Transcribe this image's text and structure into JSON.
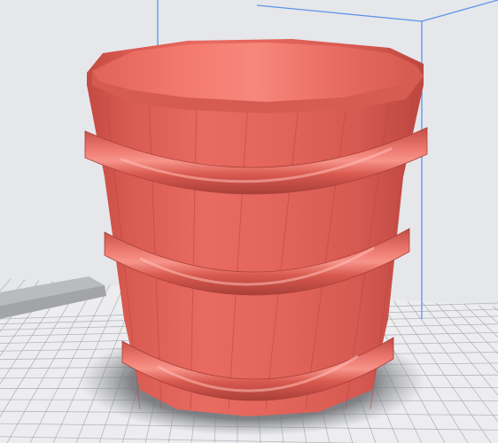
{
  "viewport": {
    "background_color": "#e3e4e8",
    "bed_color": "#ececee",
    "grid_color": "#9aa0a8",
    "build_volume_color": "#4f8fe6",
    "model_color": "#e4675e",
    "model_dark_color": "#c0463f",
    "model_light_color": "#f48a80",
    "shadow_color": "#6f7176"
  },
  "model": {
    "name_icon": "bucket-icon",
    "hoop_count": 3,
    "stave_count": 12
  }
}
